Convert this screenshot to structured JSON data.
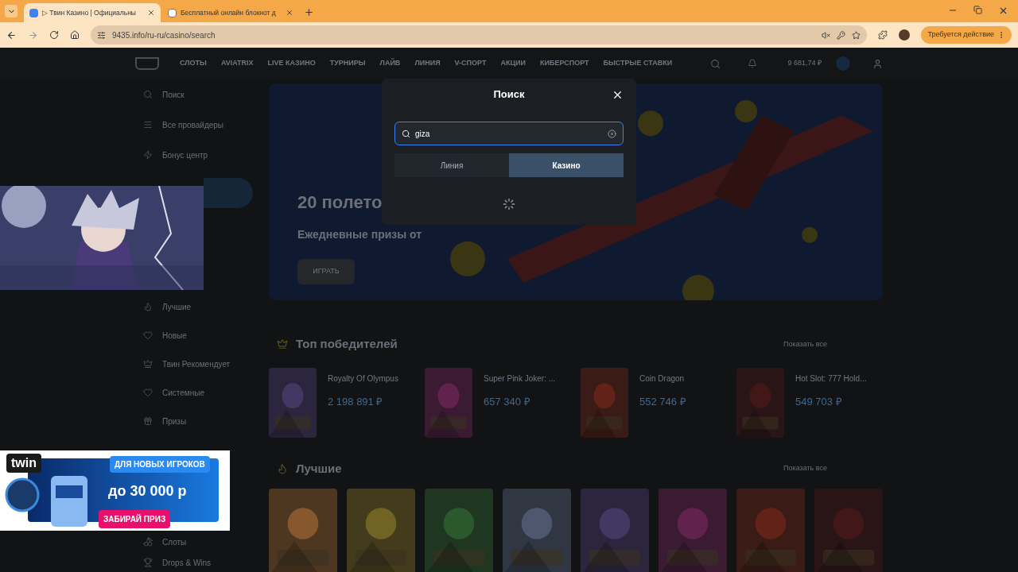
{
  "browser": {
    "tabs": [
      {
        "title": "▷ Твин Казино | Официальны",
        "selected": true
      },
      {
        "title": "Бесплатный онлайн блокнот д",
        "selected": false
      }
    ],
    "url": "9435.info/ru-ru/casino/search",
    "action_button": "Требуется действие"
  },
  "site": {
    "nav": [
      "СЛОТЫ",
      "AVIATRIX",
      "LIVE КАЗИНО",
      "ТУРНИРЫ",
      "ЛАЙВ",
      "ЛИНИЯ",
      "V-СПОРТ",
      "АКЦИИ",
      "КИБЕРСПОРТ",
      "БЫСТРЫЕ СТАВКИ"
    ],
    "balance": "9 681,74 ₽",
    "sidebar_top": [
      {
        "label": "Поиск"
      },
      {
        "label": "Все провайдеры"
      },
      {
        "label": "Бонус центр"
      }
    ],
    "sidebar_current": {
      "selected": true
    },
    "sidebar_middle": [
      {
        "label": "Лучшие"
      },
      {
        "label": "Новые"
      },
      {
        "label": "Твин Рекомендует"
      },
      {
        "label": "Системные"
      },
      {
        "label": "Призы"
      }
    ],
    "sidebar_bottom": [
      {
        "label": "Слоты"
      },
      {
        "label": "Drops & Wins"
      }
    ],
    "hero": {
      "title": "20 полето",
      "subtitle": "Ежедневные призы от",
      "button": "ИГРАТЬ"
    },
    "winners": {
      "title": "Топ победителей",
      "show_all": "Показать все",
      "items": [
        {
          "game": "Royalty Of Olympus",
          "amount": "2 198 891 ₽"
        },
        {
          "game": "Super Pink Joker: ...",
          "amount": "657 340 ₽"
        },
        {
          "game": "Coin Dragon",
          "amount": "552 746 ₽"
        },
        {
          "game": "Hot Slot: 777 Hold...",
          "amount": "549 703 ₽"
        }
      ]
    },
    "best": {
      "title": "Лучшие",
      "show_all": "Показать все"
    }
  },
  "modal": {
    "title": "Поиск",
    "query": "giza",
    "tabs": [
      {
        "label": "Линия",
        "selected": false
      },
      {
        "label": "Казино",
        "selected": true
      }
    ]
  },
  "banner": {
    "logo": "twin",
    "headline": "ДЛЯ НОВЫХ ИГРОКОВ",
    "amount": "до 30 000 р",
    "cta": "ЗАБИРАЙ ПРИЗ"
  }
}
